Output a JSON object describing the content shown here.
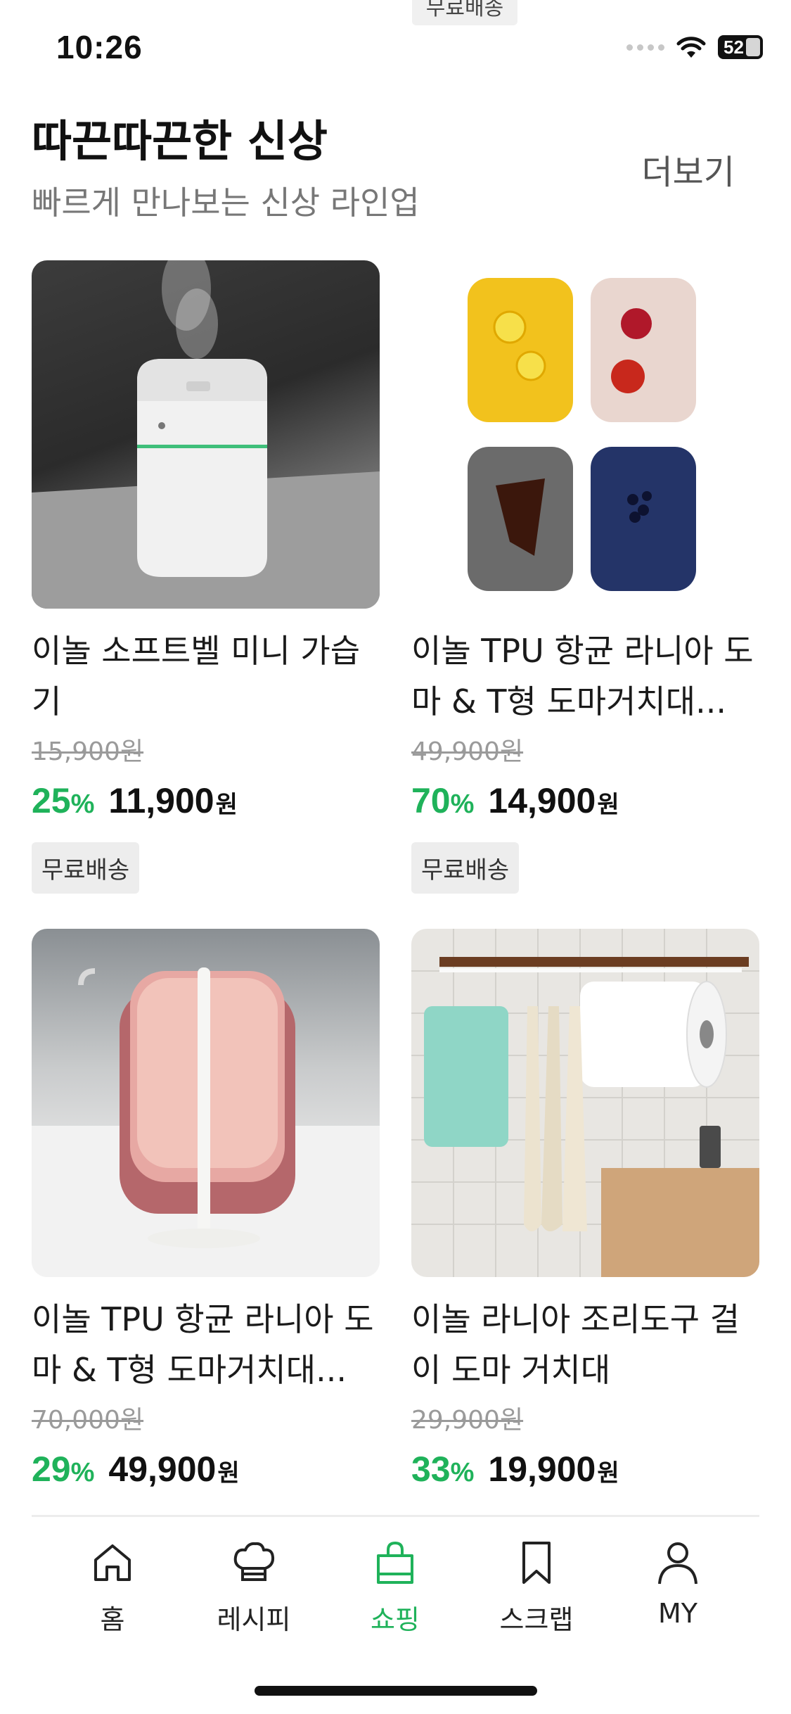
{
  "status": {
    "time": "10:26",
    "battery": "52"
  },
  "peek_badge": "무료배송",
  "section": {
    "title": "따끈따끈한 신상",
    "subtitle": "빠르게 만나보는 신상 라인업",
    "more": "더보기"
  },
  "products": [
    {
      "name": "이놀 소프트벨 미니 가습기",
      "original_price": "15,900원",
      "discount": "25",
      "pct": "%",
      "price": "11,900",
      "won": "원",
      "badge": "무료배송"
    },
    {
      "name": "이놀 TPU 항균 라니아 도마 & T형 도마거치대...",
      "original_price": "49,900원",
      "discount": "70",
      "pct": "%",
      "price": "14,900",
      "won": "원",
      "badge": "무료배송"
    },
    {
      "name": "이놀 TPU 항균 라니아 도마 & T형 도마거치대...",
      "original_price": "70,000원",
      "discount": "29",
      "pct": "%",
      "price": "49,900",
      "won": "원"
    },
    {
      "name": "이놀 라니아 조리도구 걸이 도마 거치대",
      "original_price": "29,900원",
      "discount": "33",
      "pct": "%",
      "price": "19,900",
      "won": "원"
    }
  ],
  "tabs": [
    {
      "label": "홈",
      "icon": "home-icon"
    },
    {
      "label": "레시피",
      "icon": "chef-hat-icon"
    },
    {
      "label": "쇼핑",
      "icon": "shopping-bag-icon",
      "active": true
    },
    {
      "label": "스크랩",
      "icon": "bookmark-icon"
    },
    {
      "label": "MY",
      "icon": "person-icon"
    }
  ],
  "colors": {
    "accent": "#1fb25a"
  }
}
